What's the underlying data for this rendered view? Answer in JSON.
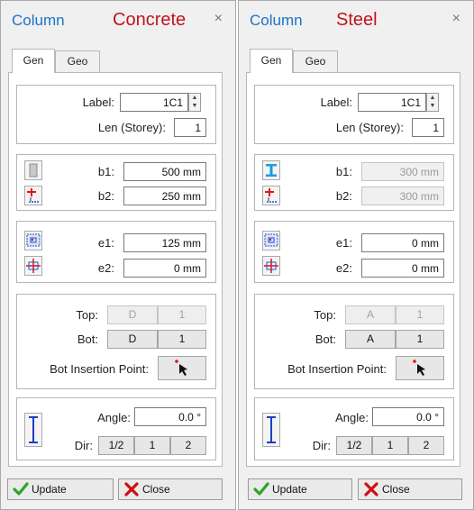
{
  "panels": [
    {
      "title": "Column",
      "type": "Concrete",
      "close": "×",
      "tabs": [
        "Gen",
        "Geo"
      ],
      "label_text": "Label:",
      "label_value": "1C1",
      "len_text": "Len (Storey):",
      "len_value": "1",
      "b1_text": "b1:",
      "b1_value": "500 mm",
      "b2_text": "b2:",
      "b2_value": "250 mm",
      "e1_text": "e1:",
      "e1_value": "125 mm",
      "e2_text": "e2:",
      "e2_value": "0 mm",
      "top_text": "Top:",
      "top_btns": [
        "D",
        "1"
      ],
      "bot_text": "Bot:",
      "bot_btns": [
        "D",
        "1"
      ],
      "insertion_text": "Bot Insertion Point:",
      "angle_text": "Angle:",
      "angle_value": "0.0 °",
      "dir_text": "Dir:",
      "dir_btns": [
        "1/2",
        "1",
        "2"
      ],
      "update_label": "Update",
      "close_label": "Close"
    },
    {
      "title": "Column",
      "type": "Steel",
      "close": "×",
      "tabs": [
        "Gen",
        "Geo"
      ],
      "label_text": "Label:",
      "label_value": "1C1",
      "len_text": "Len (Storey):",
      "len_value": "1",
      "b1_text": "b1:",
      "b1_value": "300 mm",
      "b2_text": "b2:",
      "b2_value": "300 mm",
      "e1_text": "e1:",
      "e1_value": "0 mm",
      "e2_text": "e2:",
      "e2_value": "0 mm",
      "top_text": "Top:",
      "top_btns": [
        "A",
        "1"
      ],
      "bot_text": "Bot:",
      "bot_btns": [
        "A",
        "1"
      ],
      "insertion_text": "Bot Insertion Point:",
      "angle_text": "Angle:",
      "angle_value": "0.0 °",
      "dir_text": "Dir:",
      "dir_btns": [
        "1/2",
        "1",
        "2"
      ],
      "update_label": "Update",
      "close_label": "Close"
    }
  ],
  "colors": {
    "title": "#1a73c8",
    "type": "#c0141b",
    "check": "#2aa52a",
    "cross": "#d10f0f"
  }
}
